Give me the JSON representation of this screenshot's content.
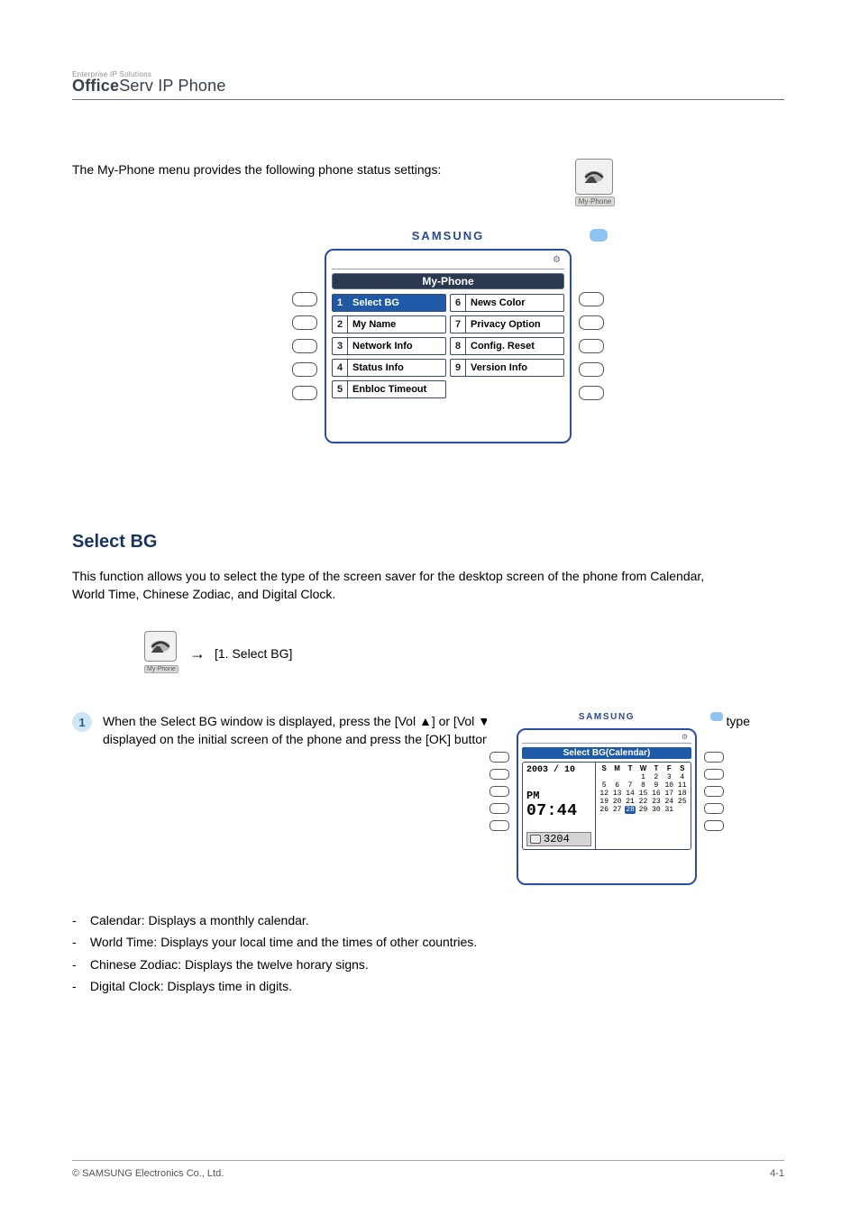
{
  "header": {
    "top_line": "Enterprise IP Solutions",
    "main_bold": "Office",
    "main_rest": "Serv",
    "main_suffix": " IP Phone"
  },
  "intro": "The My-Phone menu provides the following phone status settings:",
  "my_phone_icon_label": "My-Phone",
  "brand": "SAMSUNG",
  "screen1": {
    "title": "My-Phone",
    "left": [
      {
        "n": "1",
        "label": "Select BG",
        "selected": true
      },
      {
        "n": "2",
        "label": "My Name"
      },
      {
        "n": "3",
        "label": "Network Info"
      },
      {
        "n": "4",
        "label": "Status Info"
      },
      {
        "n": "5",
        "label": "Enbloc Timeout"
      }
    ],
    "right": [
      {
        "n": "6",
        "label": "News Color"
      },
      {
        "n": "7",
        "label": "Privacy Option"
      },
      {
        "n": "8",
        "label": "Config. Reset"
      },
      {
        "n": "9",
        "label": "Version Info"
      }
    ]
  },
  "section": {
    "heading": "Select BG",
    "sub": "This function allows you to select the type of the screen saver for the desktop screen of the phone from Calendar, World Time, Chinese Zodiac, and Digital Clock."
  },
  "path_suffix": "[1. Select BG]",
  "step1": {
    "num": "1",
    "text": "When the Select BG window is displayed, press the [Vol ▲] or [Vol ▼] button on the phone to select the screen type displayed on the initial screen of the phone and press the [OK] button."
  },
  "screen2": {
    "title": "Select BG(Calendar)",
    "date": "2003 / 10",
    "pm": "PM",
    "time": "07:44",
    "ext": "3204",
    "dow": [
      "S",
      "M",
      "T",
      "W",
      "T",
      "F",
      "S"
    ],
    "rows": [
      [
        "",
        "",
        "",
        "1",
        "2",
        "3",
        "4"
      ],
      [
        "5",
        "6",
        "7",
        "8",
        "9",
        "10",
        "11"
      ],
      [
        "12",
        "13",
        "14",
        "15",
        "16",
        "17",
        "18"
      ],
      [
        "19",
        "20",
        "21",
        "22",
        "23",
        "24",
        "25"
      ],
      [
        "26",
        "27",
        "28",
        "29",
        "30",
        "31",
        ""
      ]
    ],
    "today": "28"
  },
  "legend": [
    {
      "k": "-",
      "t": "Calendar: Displays a monthly calendar."
    },
    {
      "k": "-",
      "t": "World Time: Displays your local time and the times of other countries."
    },
    {
      "k": "-",
      "t": "Chinese Zodiac: Displays the twelve horary signs."
    },
    {
      "k": "-",
      "t": "Digital Clock: Displays time in digits."
    }
  ],
  "footer": {
    "left": "© SAMSUNG Electronics Co., Ltd.",
    "right": "4-1"
  }
}
